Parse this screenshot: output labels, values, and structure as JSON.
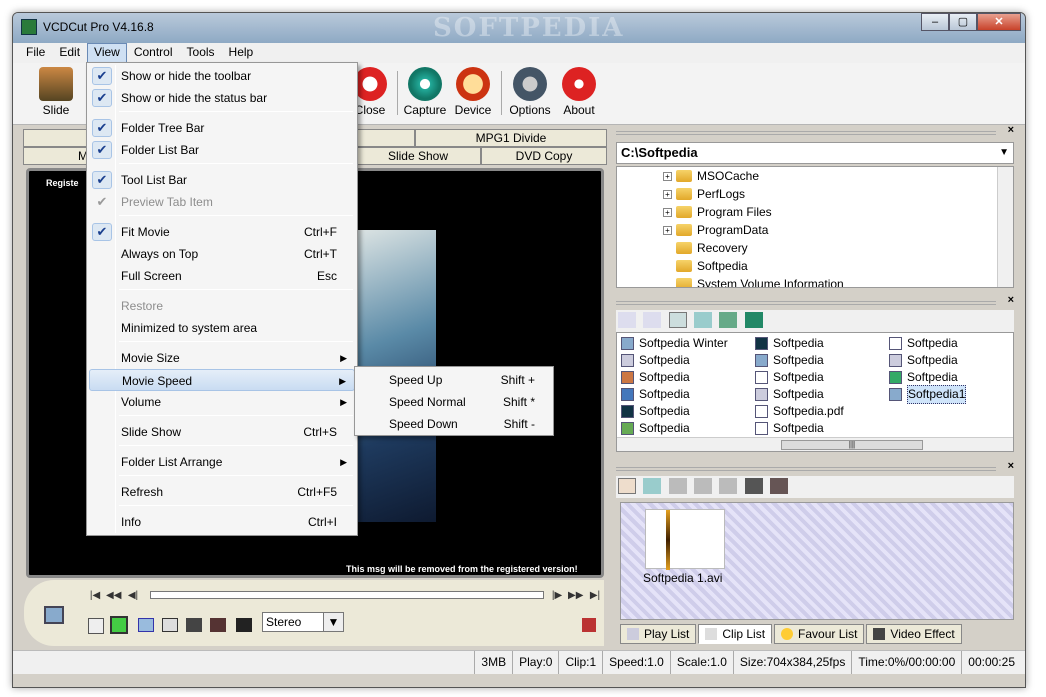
{
  "window": {
    "title": "VCDCut Pro V4.16.8",
    "watermark": "SOFTPEDIA"
  },
  "menubar": [
    "File",
    "Edit",
    "View",
    "Control",
    "Tools",
    "Help"
  ],
  "toolbar": {
    "slide": "Slide",
    "close": "Close",
    "capture": "Capture",
    "device": "Device",
    "options": "Options",
    "about": "About"
  },
  "left_tabs": {
    "mpg1_divide": "MPG1 Divide",
    "slide_show": "Slide Show",
    "dvd_copy": "DVD Copy",
    "m_tab": "M"
  },
  "video": {
    "reg_top": "Registe",
    "reg_bottom": "This msg will be removed from the registered version!"
  },
  "audio_mode": "Stereo",
  "view_menu": {
    "items": [
      {
        "label": "Show or hide the toolbar",
        "checked": true
      },
      {
        "label": "Show or hide the status bar",
        "checked": true
      },
      {
        "label": "Folder Tree Bar",
        "checked": true
      },
      {
        "label": "Folder List Bar",
        "checked": true
      },
      {
        "label": "Tool List Bar",
        "checked": true
      },
      {
        "label": "Preview Tab Item",
        "checked": true,
        "disabled": true
      },
      {
        "label": "Fit Movie",
        "shortcut": "Ctrl+F",
        "checked": true
      },
      {
        "label": "Always on Top",
        "shortcut": "Ctrl+T"
      },
      {
        "label": "Full Screen",
        "shortcut": "Esc"
      },
      {
        "label": "Restore",
        "disabled": true
      },
      {
        "label": "Minimized to system area"
      },
      {
        "label": "Movie Size",
        "submenu": true
      },
      {
        "label": "Movie Speed",
        "submenu": true,
        "highlighted": true
      },
      {
        "label": "Volume",
        "submenu": true
      },
      {
        "label": "Slide Show",
        "shortcut": "Ctrl+S"
      },
      {
        "label": "Folder List Arrange",
        "submenu": true
      },
      {
        "label": "Refresh",
        "shortcut": "Ctrl+F5"
      },
      {
        "label": "Info",
        "shortcut": "Ctrl+I"
      }
    ]
  },
  "speed_menu": [
    {
      "label": "Speed Up",
      "shortcut": "Shift +"
    },
    {
      "label": "Speed Normal",
      "shortcut": "Shift *"
    },
    {
      "label": "Speed Down",
      "shortcut": "Shift -"
    }
  ],
  "drive": "C:\\Softpedia",
  "tree": [
    "MSOCache",
    "PerfLogs",
    "Program Files",
    "ProgramData",
    "Recovery",
    "Softpedia",
    "System Volume Information"
  ],
  "files": [
    {
      "name": "Softpedia Winter",
      "icon": "image-icon"
    },
    {
      "name": "Softpedia",
      "icon": "grid-icon"
    },
    {
      "name": "Softpedia",
      "icon": "media-icon"
    },
    {
      "name": "Softpedia",
      "icon": "word-icon"
    },
    {
      "name": "Softpedia",
      "icon": "s-icon"
    },
    {
      "name": "Softpedia",
      "icon": "photo-icon"
    },
    {
      "name": "Softpedia",
      "icon": "s-icon"
    },
    {
      "name": "Softpedia",
      "icon": "image-icon"
    },
    {
      "name": "Softpedia",
      "icon": "music-icon"
    },
    {
      "name": "Softpedia",
      "icon": "grid-icon"
    },
    {
      "name": "Softpedia.pdf",
      "icon": "doc-icon"
    },
    {
      "name": "Softpedia",
      "icon": "doc-icon"
    },
    {
      "name": "Softpedia",
      "icon": "music-icon"
    },
    {
      "name": "Softpedia",
      "icon": "grid-icon"
    },
    {
      "name": "Softpedia",
      "icon": "excel-icon"
    },
    {
      "name": "Softpedia1",
      "icon": "image-icon",
      "selected": true
    }
  ],
  "clip": {
    "name": "Softpedia 1.avi"
  },
  "bottom_tabs": [
    "Play List",
    "Clip List",
    "Favour List",
    "Video Effect"
  ],
  "status": [
    "3MB",
    "Play:0",
    "Clip:1",
    "Speed:1.0",
    "Scale:1.0",
    "Size:704x384,25fps",
    "Time:0%/00:00:00",
    "00:00:25"
  ]
}
